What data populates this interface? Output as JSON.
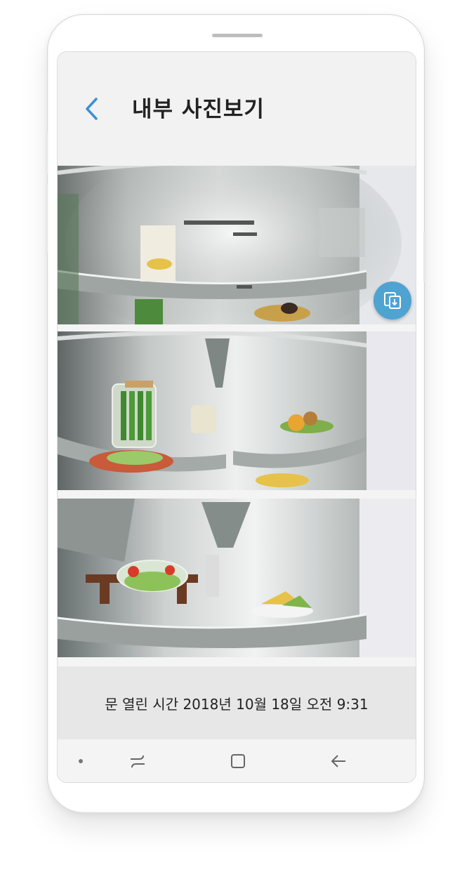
{
  "header": {
    "title": "내부 사진보기"
  },
  "photos": [
    {
      "name": "fridge-photo-1"
    },
    {
      "name": "fridge-photo-2"
    },
    {
      "name": "fridge-photo-3"
    }
  ],
  "door_info": {
    "text": "문 열린 시간 2018년 10월 18일 오전 9:31"
  },
  "colors": {
    "accent": "#4fa3d1",
    "back_arrow": "#3b8fd6",
    "title": "#222222"
  },
  "icons": {
    "back": "chevron-left-icon",
    "share": "share-exchange-icon",
    "nav_recent": "recent-apps-icon",
    "nav_home": "home-icon",
    "nav_back": "back-arrow-icon"
  }
}
